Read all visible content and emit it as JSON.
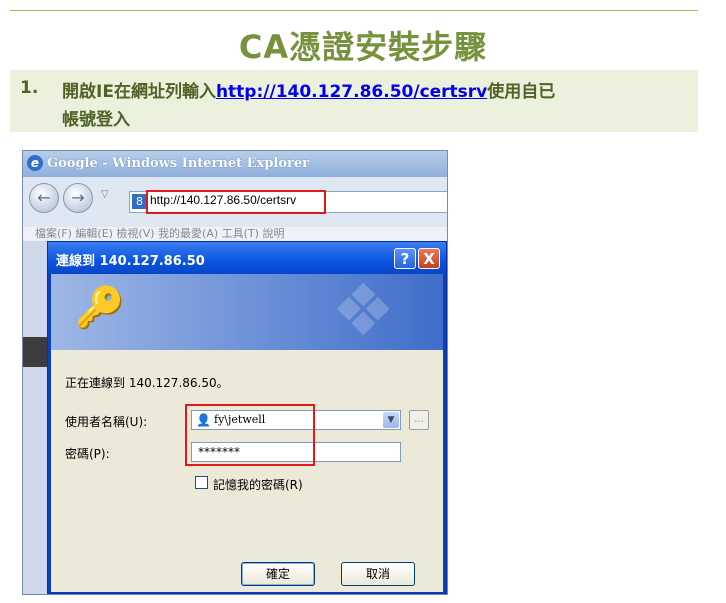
{
  "doc": {
    "title": "CA憑證安裝步驟",
    "step": {
      "number": "1.",
      "text_before": "開啟IE在網址列輸入",
      "link": "http://140.127.86.50/certsrv",
      "text_after": "使用自已",
      "line2": "帳號登入"
    }
  },
  "browser": {
    "title": "Google - Windows Internet Explorer",
    "address": "http://140.127.86.50/certsrv",
    "menu_faded": "檔案(F)   編輯(E)   檢視(V)   我的最愛(A)   工具(T)   說明"
  },
  "dialog": {
    "title": "連線到 140.127.86.50",
    "help": "?",
    "close": "X",
    "connecting": "正在連線到 140.127.86.50。",
    "username_label": "使用者名稱(U):",
    "username_value": "fy\\jetwell",
    "password_label": "密碼(P):",
    "password_value": "*******",
    "remember_label": "記憶我的密碼(R)",
    "ok": "確定",
    "cancel": "取消"
  },
  "colors": {
    "heading": "#76923c",
    "band": "#ebf1dd",
    "highlight": "#e0191a"
  }
}
